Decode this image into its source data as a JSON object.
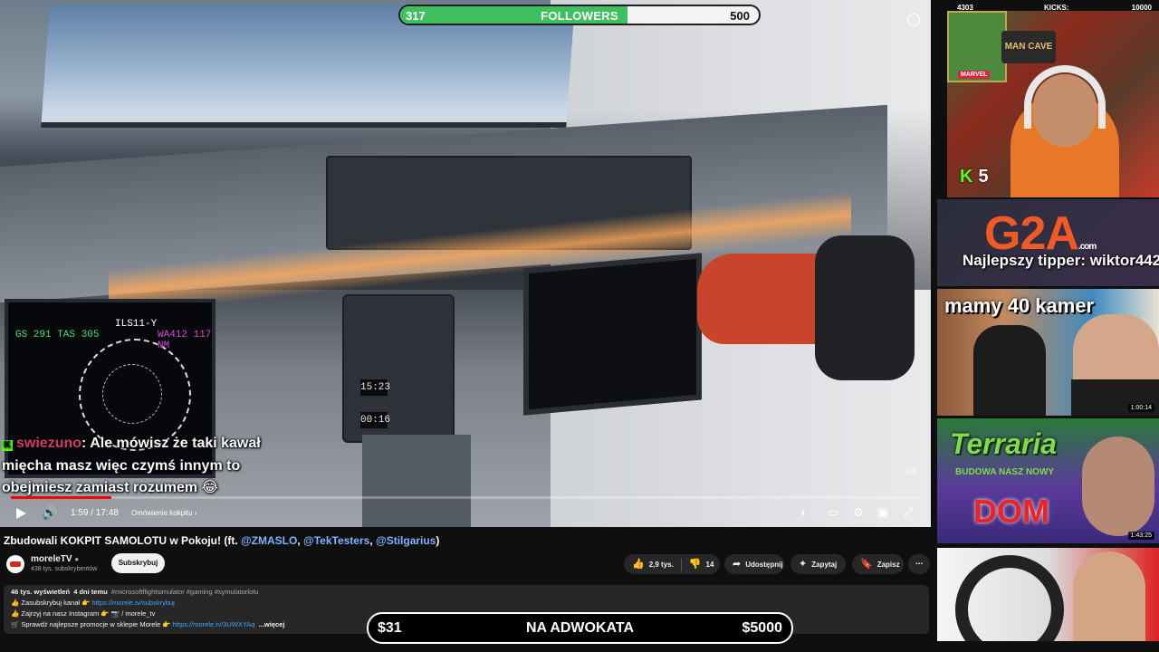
{
  "followers_goal": {
    "current": "317",
    "label": "FOLLOWERS",
    "target": "500",
    "progress": 0.634
  },
  "kicks_goal": {
    "current": "4303",
    "label": "KICKS:",
    "target": "10000"
  },
  "kick_count": "5",
  "sidebar": {
    "tipper": "Najlepszy tipper: wiktor442",
    "thumbs": [
      {
        "title": "G2A",
        "domain": ".com"
      },
      {
        "title": "mamy 40 kamer",
        "duration": "1:00:14"
      },
      {
        "title": "Terraria",
        "subtitle": "BUDOWA NASZ NOWY",
        "headline": "DOM",
        "duration": "1:43:25"
      },
      {
        "title": ""
      }
    ]
  },
  "chat": {
    "badge": "K",
    "user": "swiezuno",
    "message": ": Ale mówisz że taki kawał mięcha masz więc czymś innym to obejmiesz zamiast rozumem 😂"
  },
  "player": {
    "time": "1:59 / 17:48",
    "chapter": "Omówienie kokpitu",
    "progress": 0.111,
    "cockpit_text": {
      "pfd_left": "GS 291 TAS 305",
      "pfd_right": "WA412 117 NM",
      "pfd_mid": "ILS11-Y",
      "ecu_1": "15:23",
      "ecu_2": "00:16"
    }
  },
  "video": {
    "title_prefix": "Zbudowali KOKPIT SAMOLOTU w Pokoju! (ft. ",
    "mentions": [
      "@ZMASLO",
      "@TekTesters",
      "@Stilgarius"
    ],
    "title_suffix": ")",
    "channel": "moreleTV",
    "subscribers": "438 tys. subskrybentów",
    "subscribe_label": "Subskrybuj",
    "likes": "2,9 tys.",
    "dislikes": "14",
    "share_label": "Udostępnij",
    "ask_label": "Zapytaj",
    "save_label": "Zapisz",
    "more_label": "⋯"
  },
  "description": {
    "views": "46 tys. wyświetleń",
    "age": "4 dni temu",
    "hashtags": "#microsoftflightsimulator #gaming #symulatorlotu",
    "line1_text": "👍 Zasubskrybuj kanał 👉 ",
    "line1_link": "https://morele.tv/subskrybuj",
    "line2_text": "👍 Zajrzyj na nasz Instagram 👉 📷 / morele_tv",
    "line3_text": "🛒 Sprawdź najlepsze promocje w sklepie Morele 👉 ",
    "line3_link": "https://morele.tv/3UWXYAq",
    "more": "...więcej"
  },
  "goal_bar": {
    "left": "$31",
    "label": "NA ADWOKATA",
    "right": "$5000"
  },
  "colors": {
    "follow_green": "#3fbf5f",
    "kick_green": "#53fc18",
    "yt_red": "#ff0000",
    "link_blue": "#3ea6ff"
  }
}
